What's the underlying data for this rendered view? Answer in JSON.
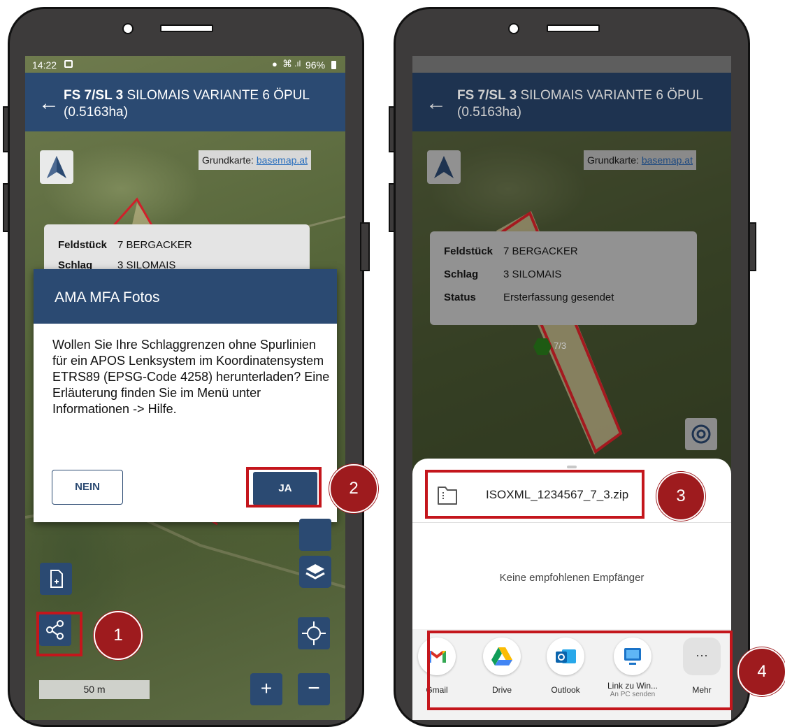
{
  "left_screen": {
    "status_time": "14:22",
    "status_battery": "96%",
    "app_title_bold": "FS 7/SL 3",
    "app_title_rest": "SILOMAIS VARIANTE 6 ÖPUL",
    "app_title_area": "(0.5163ha)",
    "basemap_label": "Grundkarte:",
    "basemap_link": "basemap.at",
    "info": {
      "feldstueck_key": "Feldstück",
      "feldstueck_val": "7 BERGACKER",
      "schlag_key": "Schlag",
      "schlag_val": "3 SILOMAIS"
    },
    "dialog": {
      "title": "AMA MFA Fotos",
      "body": "Wollen Sie Ihre Schlaggrenzen ohne Spurlinien für ein APOS Lenksystem im Koordinatensystem ETRS89 (EPSG-Code 4258) herunterladen? Eine Erläuterung finden Sie im Menü unter Informationen -> Hilfe.",
      "no_label": "NEIN",
      "yes_label": "JA"
    },
    "scale_label": "50 m",
    "zoom_in": "+",
    "zoom_out": "−"
  },
  "right_screen": {
    "app_title_bold": "FS 7/SL 3",
    "app_title_rest": "SILOMAIS VARIANTE 6 ÖPUL",
    "app_title_area": "(0.5163ha)",
    "basemap_label": "Grundkarte:",
    "basemap_link": "basemap.at",
    "info": {
      "feldstueck_key": "Feldstück",
      "feldstueck_val": "7 BERGACKER",
      "schlag_key": "Schlag",
      "schlag_val": "3 SILOMAIS",
      "status_key": "Status",
      "status_val": "Ersterfassung gesendet"
    },
    "marker_label": "7/3",
    "share": {
      "file_name": "ISOXML_1234567_7_3.zip",
      "no_recipients": "Keine empfohlenen Empfänger",
      "apps": [
        {
          "label": "Gmail",
          "sub": ""
        },
        {
          "label": "Drive",
          "sub": ""
        },
        {
          "label": "Outlook",
          "sub": ""
        },
        {
          "label": "Link zu Win...",
          "sub": "An PC senden"
        },
        {
          "label": "Mehr",
          "sub": ""
        }
      ],
      "more_glyph": "···"
    }
  },
  "badges": [
    "1",
    "2",
    "3",
    "4"
  ],
  "colors": {
    "app_bar": "#2b4a72",
    "highlight": "#c4161c",
    "badge": "#9e1b1e",
    "field_outline": "#d0202a",
    "marker": "#2e8b1e"
  }
}
